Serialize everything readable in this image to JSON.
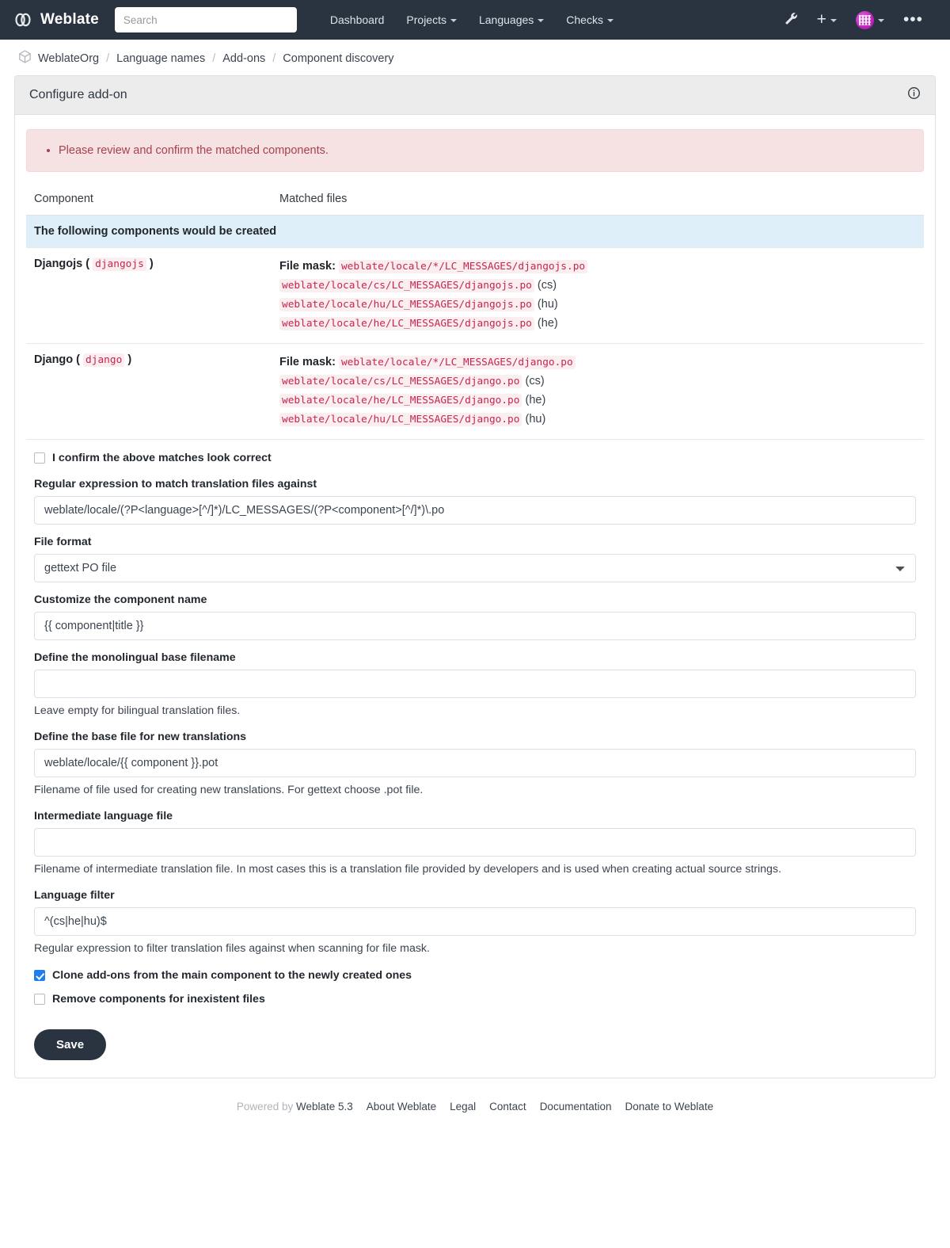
{
  "navbar": {
    "brand": "Weblate",
    "brand_icon": "weblate-logo-icon",
    "search_placeholder": "Search",
    "links": [
      {
        "label": "Dashboard",
        "has_caret": false
      },
      {
        "label": "Projects",
        "has_caret": true
      },
      {
        "label": "Languages",
        "has_caret": true
      },
      {
        "label": "Checks",
        "has_caret": true
      }
    ],
    "tools_icon": "wrench-icon",
    "add_icon": "plus-icon",
    "avatar_icon": "user-avatar",
    "more_icon": "ellipsis-icon"
  },
  "breadcrumb": {
    "icon": "cube-icon",
    "items": [
      "WeblateOrg",
      "Language names",
      "Add-ons",
      "Component discovery"
    ],
    "separator": "/"
  },
  "panel": {
    "title": "Configure add-on",
    "info_icon": "info-circle-icon"
  },
  "alert": {
    "messages": [
      "Please review and confirm the matched components."
    ]
  },
  "table": {
    "headers": [
      "Component",
      "Matched files"
    ],
    "section_title": "The following components would be created",
    "file_mask_label": "File mask:",
    "rows": [
      {
        "name": "Djangojs",
        "slug": "djangojs",
        "file_mask": "weblate/locale/*/LC_MESSAGES/djangojs.po",
        "files": [
          {
            "path": "weblate/locale/cs/LC_MESSAGES/djangojs.po",
            "lang": "(cs)"
          },
          {
            "path": "weblate/locale/hu/LC_MESSAGES/djangojs.po",
            "lang": "(hu)"
          },
          {
            "path": "weblate/locale/he/LC_MESSAGES/djangojs.po",
            "lang": "(he)"
          }
        ]
      },
      {
        "name": "Django",
        "slug": "django",
        "file_mask": "weblate/locale/*/LC_MESSAGES/django.po",
        "files": [
          {
            "path": "weblate/locale/cs/LC_MESSAGES/django.po",
            "lang": "(cs)"
          },
          {
            "path": "weblate/locale/he/LC_MESSAGES/django.po",
            "lang": "(he)"
          },
          {
            "path": "weblate/locale/hu/LC_MESSAGES/django.po",
            "lang": "(hu)"
          }
        ]
      }
    ]
  },
  "form": {
    "confirm_checkbox": {
      "label": "I confirm the above matches look correct",
      "checked": false
    },
    "regex": {
      "label": "Regular expression to match translation files against",
      "value": "weblate/locale/(?P<language>[^/]*)/LC_MESSAGES/(?P<component>[^/]*)\\.po"
    },
    "file_format": {
      "label": "File format",
      "value": "gettext PO file",
      "options": [
        "gettext PO file"
      ]
    },
    "component_name": {
      "label": "Customize the component name",
      "value": "{{ component|title }}"
    },
    "monolingual_base": {
      "label": "Define the monolingual base filename",
      "value": "",
      "help": "Leave empty for bilingual translation files."
    },
    "new_base": {
      "label": "Define the base file for new translations",
      "value": "weblate/locale/{{ component }}.pot",
      "help": "Filename of file used for creating new translations. For gettext choose .pot file."
    },
    "intermediate": {
      "label": "Intermediate language file",
      "value": "",
      "help": "Filename of intermediate translation file. In most cases this is a translation file provided by developers and is used when creating actual source strings."
    },
    "language_filter": {
      "label": "Language filter",
      "value": "^(cs|he|hu)$",
      "help": "Regular expression to filter translation files against when scanning for file mask."
    },
    "clone_addons": {
      "label": "Clone add-ons from the main component to the newly created ones",
      "checked": true
    },
    "remove_components": {
      "label": "Remove components for inexistent files",
      "checked": false
    },
    "save_label": "Save"
  },
  "footer": {
    "powered_prefix": "Powered by",
    "powered_name": "Weblate 5.3",
    "links": [
      "About Weblate",
      "Legal",
      "Contact",
      "Documentation",
      "Donate to Weblate"
    ]
  }
}
